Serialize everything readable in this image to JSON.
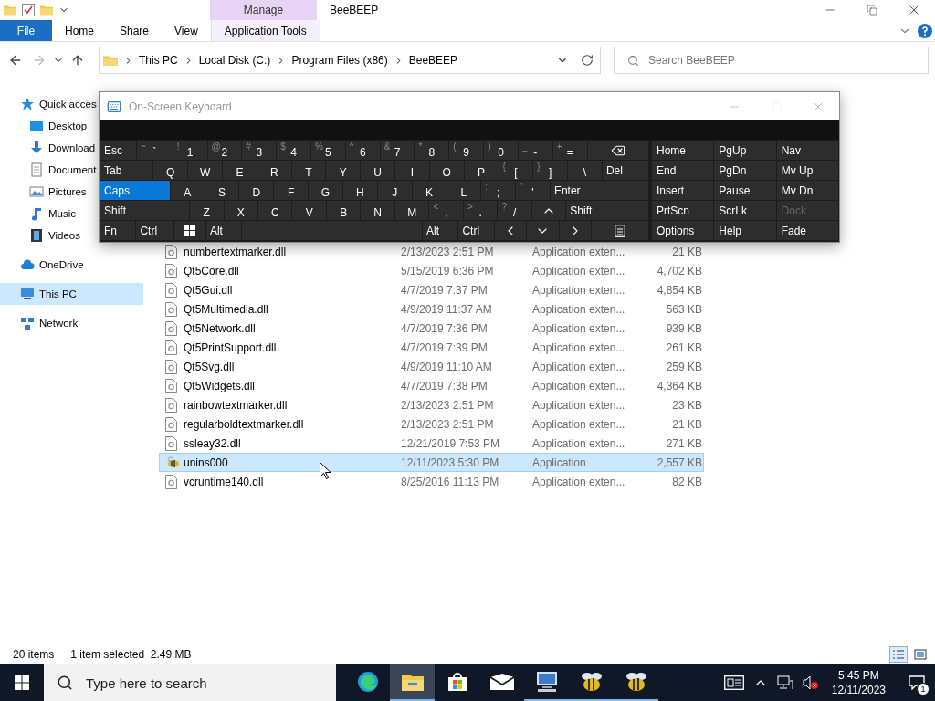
{
  "title_bar": {
    "context_tab": "Manage",
    "title": "BeeBEEP"
  },
  "ribbon_tabs": [
    {
      "label": "File",
      "kind": "file"
    },
    {
      "label": "Home",
      "kind": "plain"
    },
    {
      "label": "Share",
      "kind": "plain"
    },
    {
      "label": "View",
      "kind": "plain"
    },
    {
      "label": "Application Tools",
      "kind": "context"
    }
  ],
  "address": {
    "crumbs": [
      "This PC",
      "Local Disk (C:)",
      "Program Files (x86)",
      "BeeBEEP"
    ],
    "search_placeholder": "Search BeeBEEP"
  },
  "nav": [
    {
      "label": "Quick acces",
      "selected": false,
      "children": [
        {
          "label": "Desktop",
          "selected": false
        },
        {
          "label": "Download",
          "selected": false
        },
        {
          "label": "Document",
          "selected": false
        },
        {
          "label": "Pictures",
          "selected": false
        },
        {
          "label": "Music",
          "selected": false
        },
        {
          "label": "Videos",
          "selected": false
        }
      ]
    },
    {
      "label": "OneDrive",
      "selected": false
    },
    {
      "label": "This PC",
      "selected": true
    },
    {
      "label": "Network",
      "selected": false
    }
  ],
  "files": [
    {
      "name": "numbertextmarker.dll",
      "date": "2/13/2023 2:51 PM",
      "type": "Application exten...",
      "size": "21 KB",
      "kind": "dll",
      "selected": false
    },
    {
      "name": "Qt5Core.dll",
      "date": "5/15/2019 6:36 PM",
      "type": "Application exten...",
      "size": "4,702 KB",
      "kind": "dll",
      "selected": false
    },
    {
      "name": "Qt5Gui.dll",
      "date": "4/7/2019 7:37 PM",
      "type": "Application exten...",
      "size": "4,854 KB",
      "kind": "dll",
      "selected": false
    },
    {
      "name": "Qt5Multimedia.dll",
      "date": "4/9/2019 11:37 AM",
      "type": "Application exten...",
      "size": "563 KB",
      "kind": "dll",
      "selected": false
    },
    {
      "name": "Qt5Network.dll",
      "date": "4/7/2019 7:36 PM",
      "type": "Application exten...",
      "size": "939 KB",
      "kind": "dll",
      "selected": false
    },
    {
      "name": "Qt5PrintSupport.dll",
      "date": "4/7/2019 7:39 PM",
      "type": "Application exten...",
      "size": "261 KB",
      "kind": "dll",
      "selected": false
    },
    {
      "name": "Qt5Svg.dll",
      "date": "4/9/2019 11:10 AM",
      "type": "Application exten...",
      "size": "259 KB",
      "kind": "dll",
      "selected": false
    },
    {
      "name": "Qt5Widgets.dll",
      "date": "4/7/2019 7:38 PM",
      "type": "Application exten...",
      "size": "4,364 KB",
      "kind": "dll",
      "selected": false
    },
    {
      "name": "rainbowtextmarker.dll",
      "date": "2/13/2023 2:51 PM",
      "type": "Application exten...",
      "size": "23 KB",
      "kind": "dll",
      "selected": false
    },
    {
      "name": "regularboldtextmarker.dll",
      "date": "2/13/2023 2:51 PM",
      "type": "Application exten...",
      "size": "21 KB",
      "kind": "dll",
      "selected": false
    },
    {
      "name": "ssleay32.dll",
      "date": "12/21/2019 7:53 PM",
      "type": "Application exten...",
      "size": "271 KB",
      "kind": "dll",
      "selected": false
    },
    {
      "name": "unins000",
      "date": "12/11/2023 5:30 PM",
      "type": "Application",
      "size": "2,557 KB",
      "kind": "app",
      "selected": true
    },
    {
      "name": "vcruntime140.dll",
      "date": "8/25/2016 11:13 PM",
      "type": "Application exten...",
      "size": "82 KB",
      "kind": "dll",
      "selected": false
    }
  ],
  "status": {
    "count": "20 items",
    "selection": "1 item selected  2.49 MB"
  },
  "keyboard": {
    "title": "On-Screen Keyboard",
    "rows": [
      [
        {
          "label": "Esc",
          "kind": "mod"
        },
        {
          "label": "`",
          "shift": "~",
          "kind": "char"
        },
        {
          "label": "1",
          "shift": "!",
          "kind": "char"
        },
        {
          "label": "2",
          "shift": "@",
          "kind": "char"
        },
        {
          "label": "3",
          "shift": "#",
          "kind": "char"
        },
        {
          "label": "4",
          "shift": "$",
          "kind": "char"
        },
        {
          "label": "5",
          "shift": "%",
          "kind": "char"
        },
        {
          "label": "6",
          "shift": "^",
          "kind": "char"
        },
        {
          "label": "7",
          "shift": "&",
          "kind": "char"
        },
        {
          "label": "8",
          "shift": "*",
          "kind": "char"
        },
        {
          "label": "9",
          "shift": "(",
          "kind": "char"
        },
        {
          "label": "0",
          "shift": ")",
          "kind": "char"
        },
        {
          "label": "-",
          "shift": "_",
          "kind": "char"
        },
        {
          "label": "=",
          "shift": "+",
          "kind": "char"
        },
        {
          "kind": "backspace"
        }
      ],
      [
        {
          "label": "Tab",
          "kind": "mod"
        },
        {
          "label": "Q",
          "kind": "char"
        },
        {
          "label": "W",
          "kind": "char"
        },
        {
          "label": "E",
          "kind": "char"
        },
        {
          "label": "R",
          "kind": "char"
        },
        {
          "label": "T",
          "kind": "char"
        },
        {
          "label": "Y",
          "kind": "char"
        },
        {
          "label": "U",
          "kind": "char"
        },
        {
          "label": "I",
          "kind": "char"
        },
        {
          "label": "O",
          "kind": "char"
        },
        {
          "label": "P",
          "kind": "char"
        },
        {
          "label": "[",
          "shift": "{",
          "kind": "char"
        },
        {
          "label": "]",
          "shift": "}",
          "kind": "char"
        },
        {
          "label": "\\",
          "shift": "|",
          "kind": "char"
        },
        {
          "label": "Del",
          "kind": "mod"
        }
      ],
      [
        {
          "label": "Caps",
          "kind": "mod",
          "on": true
        },
        {
          "label": "A",
          "kind": "char"
        },
        {
          "label": "S",
          "kind": "char"
        },
        {
          "label": "D",
          "kind": "char"
        },
        {
          "label": "F",
          "kind": "char"
        },
        {
          "label": "G",
          "kind": "char"
        },
        {
          "label": "H",
          "kind": "char"
        },
        {
          "label": "J",
          "kind": "char"
        },
        {
          "label": "K",
          "kind": "char"
        },
        {
          "label": "L",
          "kind": "char"
        },
        {
          "label": ";",
          "shift": ":",
          "kind": "char"
        },
        {
          "label": "'",
          "shift": "\"",
          "kind": "char"
        },
        {
          "label": "Enter",
          "kind": "mod"
        }
      ],
      [
        {
          "label": "Shift",
          "kind": "mod",
          "on": false
        },
        {
          "label": "Z",
          "kind": "char"
        },
        {
          "label": "X",
          "kind": "char"
        },
        {
          "label": "C",
          "kind": "char"
        },
        {
          "label": "V",
          "kind": "char"
        },
        {
          "label": "B",
          "kind": "char"
        },
        {
          "label": "N",
          "kind": "char"
        },
        {
          "label": "M",
          "kind": "char"
        },
        {
          "label": ",",
          "shift": "<",
          "kind": "char"
        },
        {
          "label": ".",
          "shift": ">",
          "kind": "char"
        },
        {
          "label": "/",
          "shift": "?",
          "kind": "char"
        },
        {
          "kind": "up"
        },
        {
          "label": "Shift",
          "kind": "mod",
          "on": false
        }
      ],
      [
        {
          "label": "Fn",
          "kind": "mod",
          "on": false
        },
        {
          "label": "Ctrl",
          "kind": "mod",
          "on": false
        },
        {
          "kind": "windows"
        },
        {
          "label": "Alt",
          "kind": "mod",
          "on": false
        },
        {
          "kind": "space"
        },
        {
          "label": "Alt",
          "kind": "mod",
          "on": false
        },
        {
          "label": "Ctrl",
          "kind": "mod",
          "on": false
        },
        {
          "kind": "left"
        },
        {
          "kind": "down"
        },
        {
          "kind": "right"
        },
        {
          "kind": "menu"
        }
      ]
    ],
    "nav_keys": [
      {
        "label": "Home",
        "disabled": false
      },
      {
        "label": "PgUp",
        "disabled": false
      },
      {
        "label": "Nav",
        "disabled": false
      },
      {
        "label": "End",
        "disabled": false
      },
      {
        "label": "PgDn",
        "disabled": false
      },
      {
        "label": "Mv Up",
        "disabled": false
      },
      {
        "label": "Insert",
        "disabled": false
      },
      {
        "label": "Pause",
        "disabled": false
      },
      {
        "label": "Mv Dn",
        "disabled": false
      },
      {
        "label": "PrtScn",
        "disabled": false
      },
      {
        "label": "ScrLk",
        "disabled": false
      },
      {
        "label": "Dock",
        "disabled": true
      },
      {
        "label": "Options",
        "disabled": false
      },
      {
        "label": "Help",
        "disabled": false
      },
      {
        "label": "Fade",
        "disabled": false
      }
    ]
  },
  "taskbar": {
    "search_placeholder": "Type here to search",
    "apps": [
      {
        "kind": "edge",
        "running": false,
        "active": false
      },
      {
        "kind": "explorer",
        "running": true,
        "active": true
      },
      {
        "kind": "store",
        "running": false,
        "active": false
      },
      {
        "kind": "mail",
        "running": false,
        "active": false
      },
      {
        "kind": "monitor",
        "running": true,
        "active": false
      },
      {
        "kind": "bee",
        "running": true,
        "active": false
      },
      {
        "kind": "bee",
        "running": true,
        "active": false
      }
    ],
    "time": "5:45 PM",
    "date": "12/11/2023",
    "notifications": "1"
  }
}
